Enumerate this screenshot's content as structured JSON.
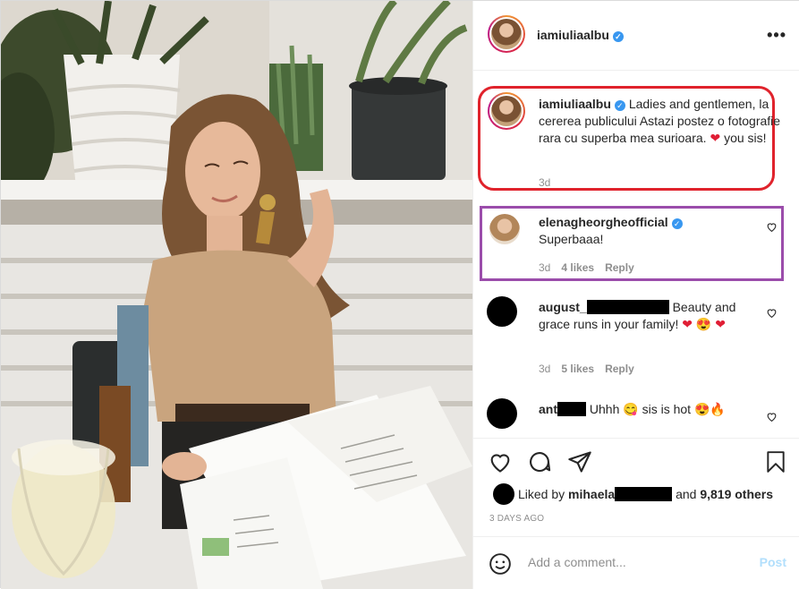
{
  "post": {
    "author": {
      "username": "iamiuliaalbu",
      "verified": true
    },
    "caption": {
      "username": "iamiuliaalbu",
      "text_before_heart": "Ladies and gentlemen, la cererea publicului Astazi postez o fotografie rara cu superba mea surioara.",
      "heart": "❤",
      "text_after_heart": "you sis!",
      "time": "3d"
    },
    "comments": [
      {
        "username": "elenagheorgheofficial",
        "verified": true,
        "text": "Superbaaa!",
        "time": "3d",
        "likes": "4 likes",
        "reply": "Reply"
      },
      {
        "username_prefix": "august_",
        "redacted": true,
        "text": "Beauty and grace runs in your family!",
        "emojis": [
          "❤",
          "😍",
          "❤"
        ],
        "time": "3d",
        "likes": "5 likes",
        "reply": "Reply"
      },
      {
        "username_prefix": "ant",
        "redacted": true,
        "text": "Uhhh",
        "emoji_a": "😋",
        "text2": "sis is hot",
        "emojis": [
          "😍",
          "🔥"
        ]
      }
    ],
    "liked_by": {
      "prefix": "Liked by",
      "user": "mihaela",
      "and": "and",
      "others": "9,819 others"
    },
    "time_ago": "3 DAYS AGO",
    "add_comment_placeholder": "Add a comment...",
    "post_button": "Post"
  },
  "colors": {
    "caption_highlight": "#e0232c",
    "reply_highlight": "#9b4dab",
    "link_blue_disabled": "#b2dffc",
    "verified_blue": "#3897f0"
  },
  "icons": [
    "more-icon",
    "heart-icon",
    "comment-icon",
    "share-icon",
    "bookmark-icon",
    "smile-icon",
    "verified-icon"
  ]
}
